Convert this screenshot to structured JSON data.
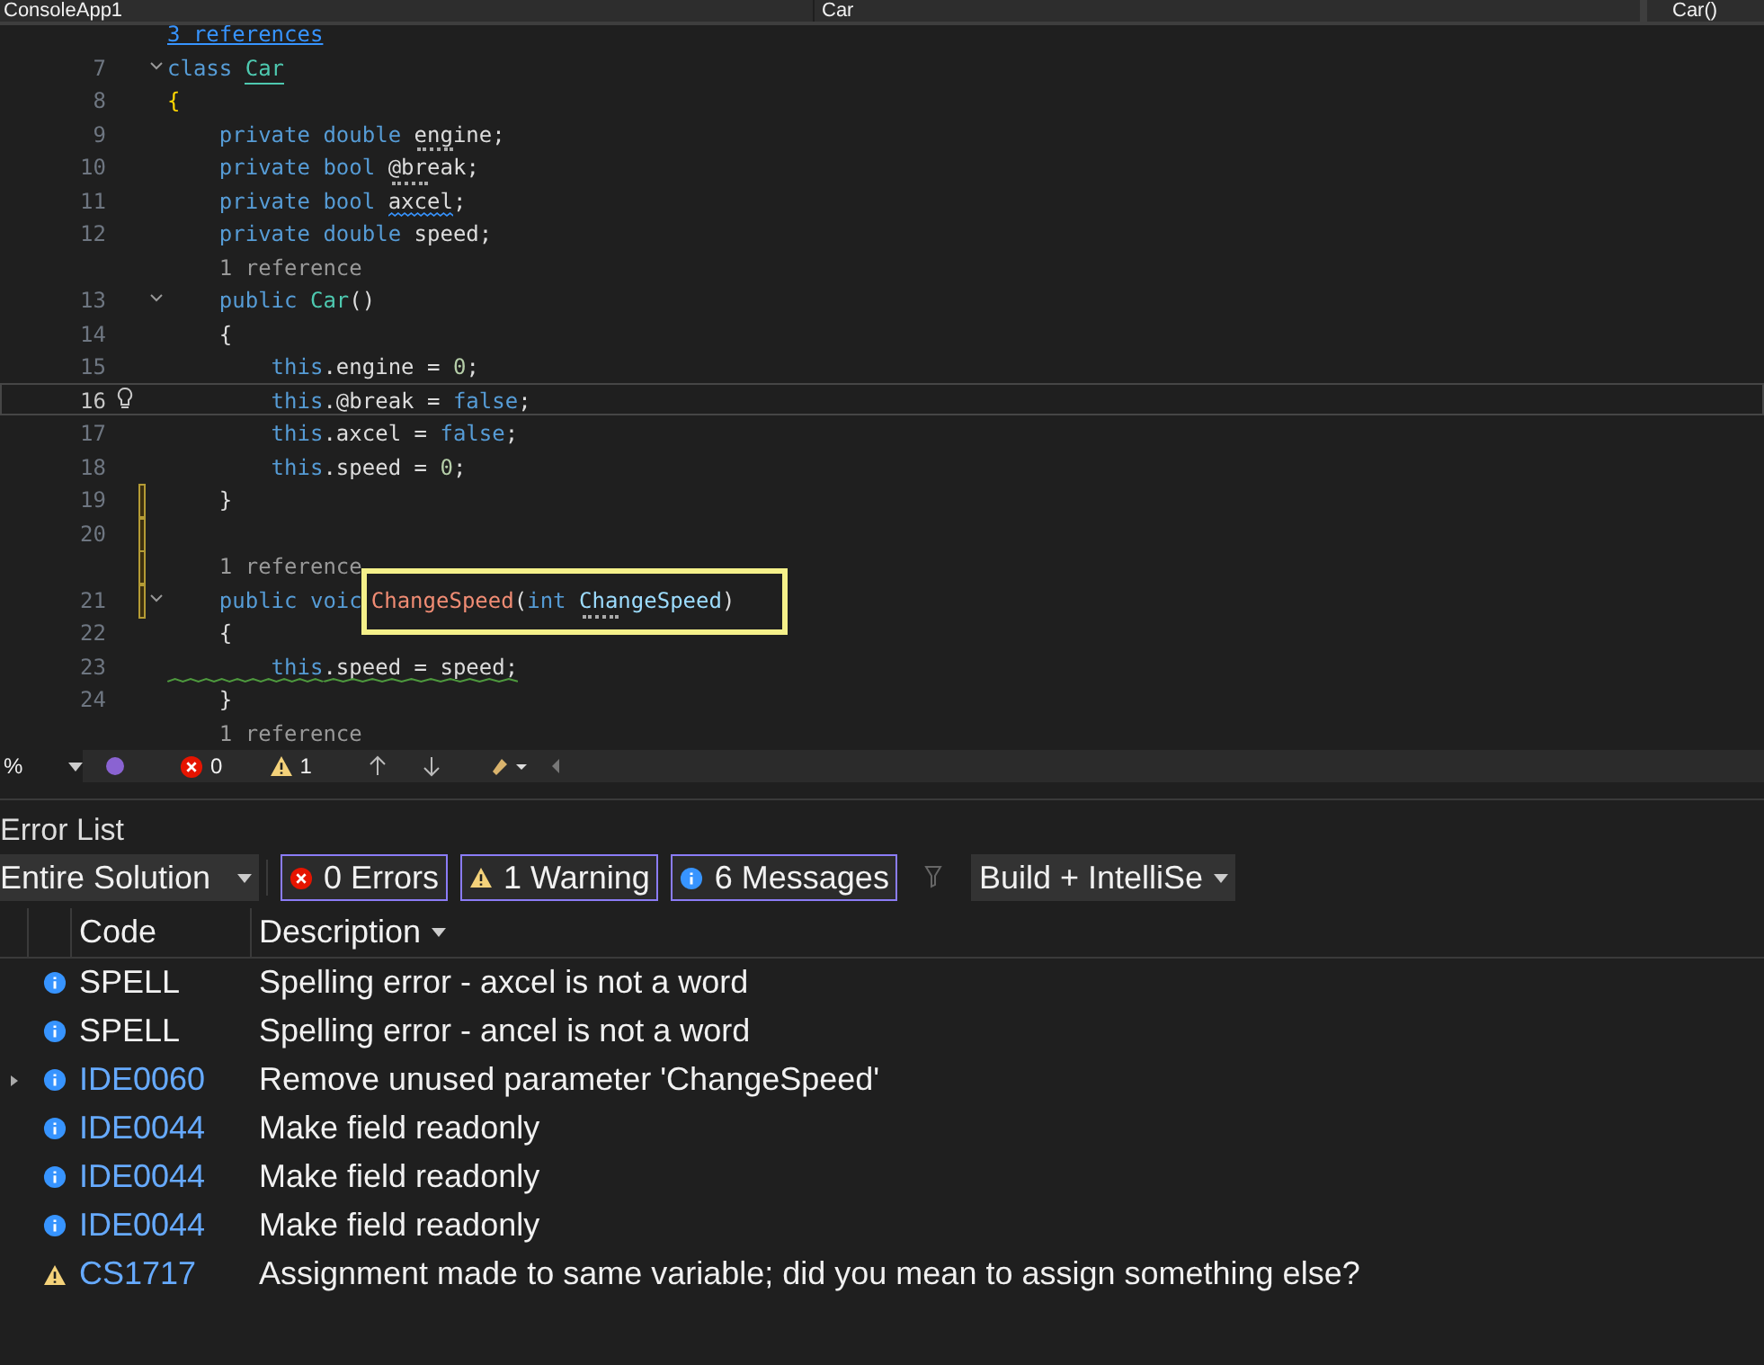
{
  "tabs_bar": {
    "project": "ConsoleApp1",
    "class_selector": "Car",
    "member_selector": "Car()"
  },
  "editor": {
    "lines": [
      {
        "kind": "lens",
        "tokens": [
          {
            "text": "3 references",
            "kind": "link"
          }
        ]
      },
      {
        "kind": "code",
        "number": "7",
        "fold": true,
        "tokens": [
          {
            "text": "class ",
            "kind": "keyword"
          },
          {
            "text": "Car",
            "kind": "type",
            "underlined": true
          }
        ]
      },
      {
        "kind": "code",
        "number": "8",
        "tokens": [
          {
            "text": "{",
            "kind": "brace"
          }
        ]
      },
      {
        "kind": "code",
        "number": "9",
        "tokens": [
          {
            "text": "    private double ",
            "kind": "keyword"
          },
          {
            "text": "engine",
            "kind": "plain",
            "dotted": true
          },
          {
            "text": ";",
            "kind": "plain"
          }
        ]
      },
      {
        "kind": "code",
        "number": "10",
        "tokens": [
          {
            "text": "    private bool ",
            "kind": "keyword"
          },
          {
            "text": "@break",
            "kind": "plain",
            "dotted": true
          },
          {
            "text": ";",
            "kind": "plain"
          }
        ]
      },
      {
        "kind": "code",
        "number": "11",
        "tokens": [
          {
            "text": "    private bool ",
            "kind": "keyword"
          },
          {
            "text": "axcel",
            "kind": "plain",
            "misspelled": true
          },
          {
            "text": ";",
            "kind": "plain"
          }
        ]
      },
      {
        "kind": "code",
        "number": "12",
        "tokens": [
          {
            "text": "    private double ",
            "kind": "keyword"
          },
          {
            "text": "speed",
            "kind": "plain"
          },
          {
            "text": ";",
            "kind": "plain"
          }
        ]
      },
      {
        "kind": "lens",
        "tokens": [
          {
            "text": "    1 reference",
            "kind": "lens"
          }
        ]
      },
      {
        "kind": "code",
        "number": "13",
        "fold": true,
        "tokens": [
          {
            "text": "    public ",
            "kind": "keyword"
          },
          {
            "text": "Car",
            "kind": "type"
          },
          {
            "text": "()",
            "kind": "plain"
          }
        ]
      },
      {
        "kind": "code",
        "number": "14",
        "tokens": [
          {
            "text": "    {",
            "kind": "plain"
          }
        ]
      },
      {
        "kind": "code",
        "number": "15",
        "tokens": [
          {
            "text": "        this",
            "kind": "keyword"
          },
          {
            "text": ".engine = ",
            "kind": "plain"
          },
          {
            "text": "0",
            "kind": "number"
          },
          {
            "text": ";",
            "kind": "plain"
          }
        ]
      },
      {
        "kind": "code",
        "number": "16",
        "current": true,
        "bulb": true,
        "tokens": [
          {
            "text": "        this",
            "kind": "keyword"
          },
          {
            "text": ".@break = ",
            "kind": "plain"
          },
          {
            "text": "false",
            "kind": "keyword"
          },
          {
            "text": ";",
            "kind": "plain"
          }
        ]
      },
      {
        "kind": "code",
        "number": "17",
        "tokens": [
          {
            "text": "        this",
            "kind": "keyword"
          },
          {
            "text": ".axcel = ",
            "kind": "plain"
          },
          {
            "text": "false",
            "kind": "keyword"
          },
          {
            "text": ";",
            "kind": "plain"
          }
        ]
      },
      {
        "kind": "code",
        "number": "18",
        "tokens": [
          {
            "text": "        this",
            "kind": "keyword"
          },
          {
            "text": ".speed = ",
            "kind": "plain"
          },
          {
            "text": "0",
            "kind": "number"
          },
          {
            "text": ";",
            "kind": "plain"
          }
        ]
      },
      {
        "kind": "code",
        "number": "19",
        "changed": true,
        "tokens": [
          {
            "text": "    }",
            "kind": "plain"
          }
        ]
      },
      {
        "kind": "code",
        "number": "20",
        "changed": true
      },
      {
        "kind": "lens",
        "changed": true,
        "tokens": [
          {
            "text": "    1 reference",
            "kind": "lens"
          }
        ]
      },
      {
        "kind": "code",
        "number": "21",
        "changed": true,
        "fold": true,
        "tokens": [
          {
            "text": "    public voic",
            "kind": "keyword"
          },
          {
            "text": "ChangeSpeed",
            "kind": "method",
            "boxed": true
          },
          {
            "text": "(",
            "kind": "plain",
            "boxed": true
          },
          {
            "text": "int ",
            "kind": "keyword",
            "boxed": true
          },
          {
            "text": "ChangeSpeed",
            "kind": "param",
            "boxed": true,
            "dotted": true
          },
          {
            "text": ")",
            "kind": "plain",
            "boxed": true
          }
        ]
      },
      {
        "kind": "code",
        "number": "22",
        "tokens": [
          {
            "text": "    {",
            "kind": "plain"
          }
        ]
      },
      {
        "kind": "code",
        "number": "23",
        "tokens": [
          {
            "text": "        this",
            "kind": "keyword",
            "suggestion": true
          },
          {
            "text": ".speed = speed;",
            "kind": "plain",
            "suggestion": true
          }
        ]
      },
      {
        "kind": "code",
        "number": "24",
        "tokens": [
          {
            "text": "    }",
            "kind": "plain"
          }
        ]
      },
      {
        "kind": "lens",
        "tokens": [
          {
            "text": "    1 reference",
            "kind": "lens"
          }
        ]
      }
    ]
  },
  "editor_status": {
    "zoom": "%",
    "errors": "0",
    "warnings": "1"
  },
  "error_list": {
    "title": "Error List",
    "scope": "Entire Solution",
    "filters": [
      {
        "kind": "error",
        "label": "0 Errors",
        "selected": true
      },
      {
        "kind": "warning",
        "label": "1 Warning",
        "selected": true
      },
      {
        "kind": "info",
        "label": "6 Messages",
        "selected": true
      }
    ],
    "source": "Build + IntelliSe",
    "columns": [
      "Code",
      "Description"
    ],
    "rows": [
      {
        "kind": "info",
        "code": "SPELL",
        "linked": false,
        "expandable": false,
        "description": "Spelling error - axcel is not a word"
      },
      {
        "kind": "info",
        "code": "SPELL",
        "linked": false,
        "expandable": false,
        "description": "Spelling error - ancel is not a word"
      },
      {
        "kind": "info",
        "code": "IDE0060",
        "linked": true,
        "expandable": true,
        "description": "Remove unused parameter 'ChangeSpeed'"
      },
      {
        "kind": "info",
        "code": "IDE0044",
        "linked": true,
        "expandable": false,
        "description": "Make field readonly"
      },
      {
        "kind": "info",
        "code": "IDE0044",
        "linked": true,
        "expandable": false,
        "description": "Make field readonly"
      },
      {
        "kind": "info",
        "code": "IDE0044",
        "linked": true,
        "expandable": false,
        "description": "Make field readonly"
      },
      {
        "kind": "warning",
        "code": "CS1717",
        "linked": true,
        "expandable": false,
        "description": "Assignment made to same variable; did you mean to assign something else?"
      }
    ]
  }
}
